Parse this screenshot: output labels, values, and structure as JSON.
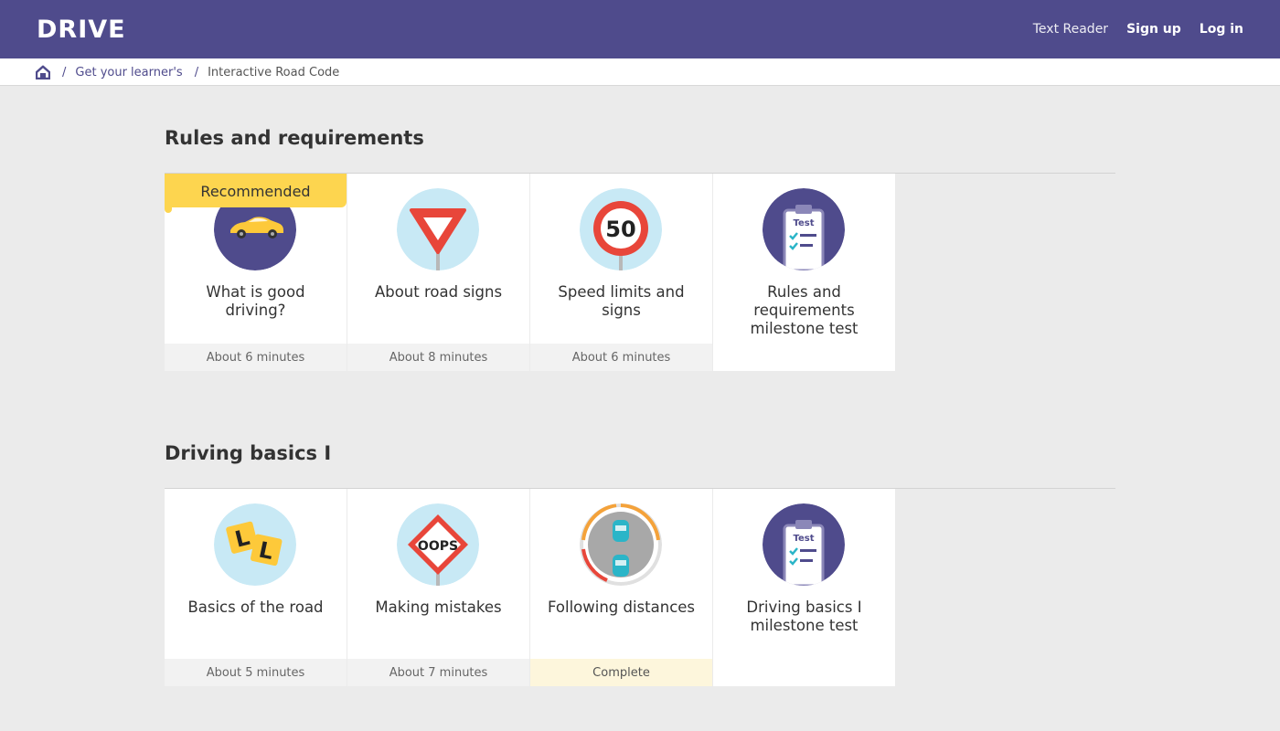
{
  "header": {
    "logo": "DRIVE",
    "nav": {
      "text_reader": "Text Reader",
      "sign_up": "Sign up",
      "log_in": "Log in"
    },
    "background_color": "#4f4b8c"
  },
  "breadcrumb": {
    "home_icon": "home-icon",
    "items": [
      "Get your learner's",
      "Interactive Road Code"
    ]
  },
  "sections": [
    {
      "title": "Rules and requirements",
      "cards": [
        {
          "title": "What is good driving?",
          "footer": "About 6 minutes",
          "badge": "Recommended",
          "icon": "yellow-car-icon"
        },
        {
          "title": "About road signs",
          "footer": "About 8 minutes",
          "icon": "give-way-sign-icon"
        },
        {
          "title": "Speed limits and signs",
          "footer": "About 6 minutes",
          "icon": "speed-limit-50-sign-icon",
          "sign_text": "50"
        },
        {
          "title": "Rules and requirements milestone test",
          "footer": "",
          "icon": "test-clipboard-icon",
          "sign_text": "Test"
        }
      ]
    },
    {
      "title": "Driving basics I",
      "cards": [
        {
          "title": "Basics of the road",
          "footer": "About 5 minutes",
          "icon": "learner-plates-icon",
          "sign_text": "L"
        },
        {
          "title": "Making mistakes",
          "footer": "About 7 minutes",
          "icon": "oops-sign-icon",
          "sign_text": "OOPS"
        },
        {
          "title": "Following distances",
          "footer": "Complete",
          "icon": "following-distance-cars-icon"
        },
        {
          "title": "Driving basics I milestone test",
          "footer": "",
          "icon": "test-clipboard-icon",
          "sign_text": "Test"
        }
      ]
    }
  ],
  "colors": {
    "brand": "#4f4b8c",
    "badge": "#fdd54f",
    "complete_footer": "#fdf6dc",
    "icon_light_blue": "#c8e9f5"
  }
}
